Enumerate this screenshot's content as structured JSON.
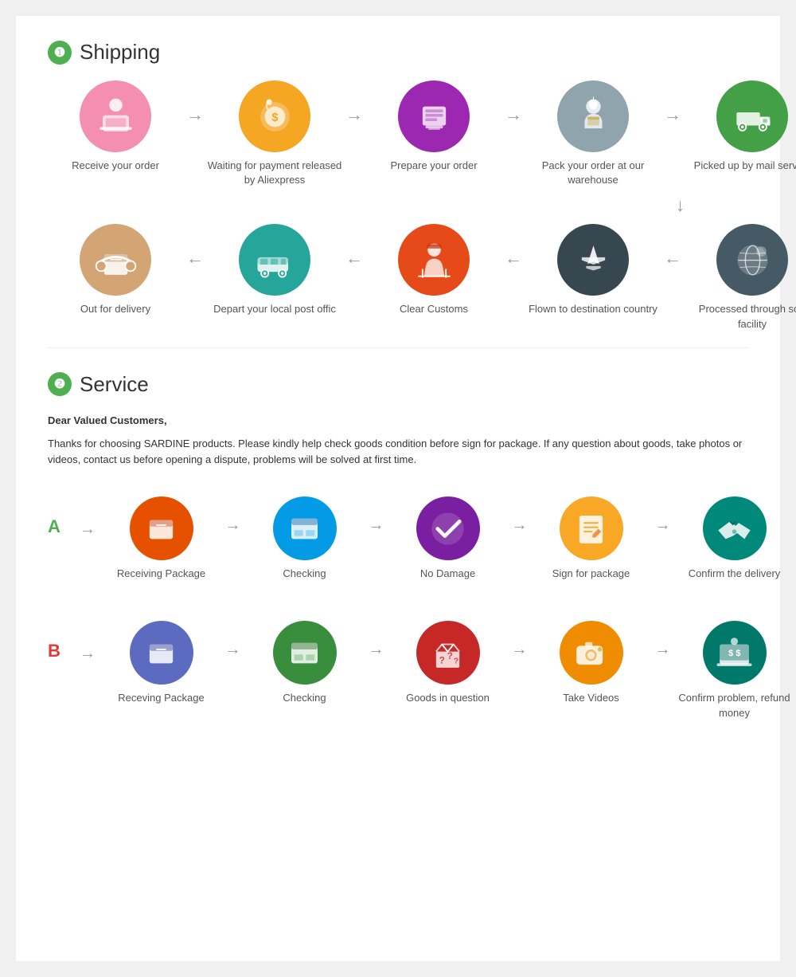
{
  "shipping": {
    "section_number": "❶",
    "section_title": "Shipping",
    "row1": [
      {
        "label": "Receive your order",
        "icon_class": "ic-pink",
        "icon": "🧑‍💻"
      },
      {
        "label": "Waiting for payment released by Aliexpress",
        "icon_class": "ic-orange-gold",
        "icon": "💰"
      },
      {
        "label": "Prepare your order",
        "icon_class": "ic-purple",
        "icon": "🖨️"
      },
      {
        "label": "Pack your order at our warehouse",
        "icon_class": "ic-gray",
        "icon": "📦"
      },
      {
        "label": "Picked up by mail service",
        "icon_class": "ic-green",
        "icon": "🚚"
      }
    ],
    "row2": [
      {
        "label": "Out for delivery",
        "icon_class": "ic-tan",
        "icon": "📦"
      },
      {
        "label": "Depart your local post offic",
        "icon_class": "ic-teal-blue",
        "icon": "🚐"
      },
      {
        "label": "Clear  Customs",
        "icon_class": "ic-orange-red",
        "icon": "🛃"
      },
      {
        "label": "Flown to destination country",
        "icon_class": "ic-steel-blue",
        "icon": "✈️"
      },
      {
        "label": "Processed through sort facility",
        "icon_class": "ic-dark-blue-gray",
        "icon": "🌍"
      }
    ]
  },
  "service": {
    "section_number": "❷",
    "section_title": "Service",
    "intro_bold": "Dear Valued Customers,",
    "intro_text": "Thanks for choosing SARDINE products. Please kindly help check goods condition before sign for package. If any question about goods, take photos or videos, contact us before opening a dispute, problems will be solved at first time.",
    "scenario_a": {
      "label": "A",
      "items": [
        {
          "label": "Receiving Package",
          "icon_class": "ic-orange-a",
          "icon": "📦"
        },
        {
          "label": "Checking",
          "icon_class": "ic-blue-a",
          "icon": "📦"
        },
        {
          "label": "No Damage",
          "icon_class": "ic-purple-a",
          "icon": "✔"
        },
        {
          "label": "Sign for package",
          "icon_class": "ic-amber",
          "icon": "📋"
        },
        {
          "label": "Confirm the delivery",
          "icon_class": "ic-teal-a",
          "icon": "🤝"
        }
      ]
    },
    "scenario_b": {
      "label": "B",
      "items": [
        {
          "label": "Receving Package",
          "icon_class": "ic-indigo",
          "icon": "📦"
        },
        {
          "label": "Checking",
          "icon_class": "ic-green-b",
          "icon": "📦"
        },
        {
          "label": "Goods in question",
          "icon_class": "ic-red-b",
          "icon": "❓"
        },
        {
          "label": "Take Videos",
          "icon_class": "ic-amber-b",
          "icon": "📷"
        },
        {
          "label": "Confirm problem, refund money",
          "icon_class": "ic-teal-b",
          "icon": "💻"
        }
      ]
    }
  }
}
